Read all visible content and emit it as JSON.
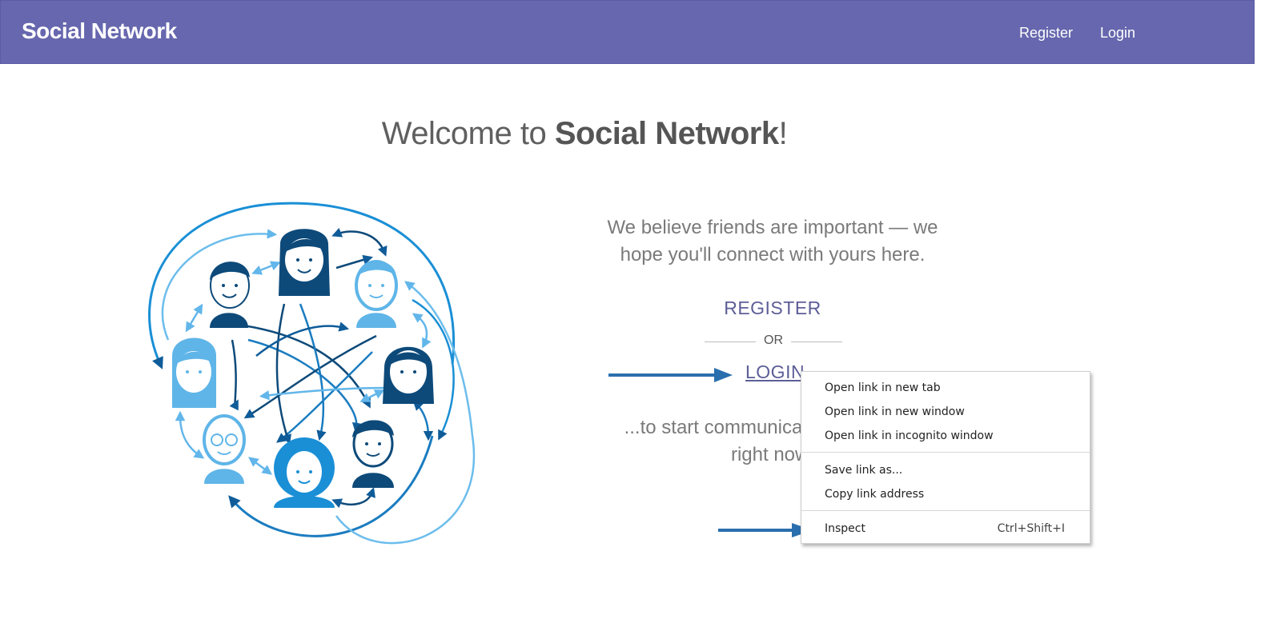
{
  "navbar": {
    "brand": "Social Network",
    "links": [
      {
        "label": "Register"
      },
      {
        "label": "Login"
      }
    ],
    "background": "#6667ae"
  },
  "main": {
    "welcome_prefix": "Welcome to ",
    "welcome_brand": "Social Network",
    "welcome_suffix": "!",
    "tagline": "We believe friends are important — we hope you'll connect with yours here.",
    "register_label": "REGISTER",
    "or_label": "OR",
    "login_label": "LOGIN",
    "subtext": "...to start communicating with them right now!"
  },
  "context_menu": {
    "items": [
      {
        "label": "Open link in new tab"
      },
      {
        "label": "Open link in new window"
      },
      {
        "label": "Open link in incognito window"
      },
      {
        "label": "Save link as..."
      },
      {
        "label": "Copy link address"
      },
      {
        "label": "Inspect",
        "shortcut": "Ctrl+Shift+I"
      }
    ]
  },
  "colors": {
    "accent": "#6667ae",
    "annotation_arrow": "#2a6fad",
    "illustration_dark": "#0d4a7a",
    "illustration_light": "#5fb5e8"
  }
}
